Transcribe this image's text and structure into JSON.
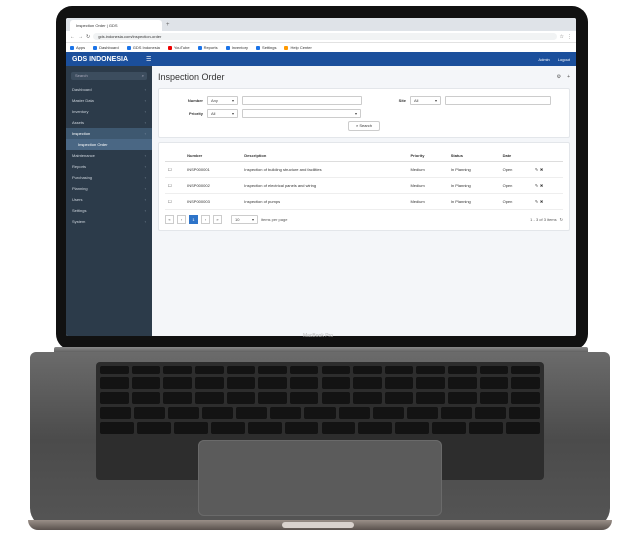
{
  "browser": {
    "tab_title": "Inspection Order | GDS",
    "address": "gds.indonesia.com/inspection-order",
    "bookmarks": [
      "Apps",
      "Dashboard",
      "GDS Indonesia",
      "YouTube",
      "Reports",
      "Inventory",
      "Settings",
      "Help Center"
    ]
  },
  "app": {
    "brand": "GDS INDONESIA",
    "user": [
      "Admin",
      "Logout"
    ],
    "search_placeholder": "Search",
    "menu": [
      {
        "label": "Dashboard"
      },
      {
        "label": "Master Data"
      },
      {
        "label": "Inventory"
      },
      {
        "label": "Assets"
      },
      {
        "label": "Inspection",
        "active": true
      },
      {
        "label": "Inspection Order",
        "sub": true,
        "active": true
      },
      {
        "label": "Maintenance"
      },
      {
        "label": "Reports"
      },
      {
        "label": "Purchasing"
      },
      {
        "label": "Planning"
      },
      {
        "label": "Users"
      },
      {
        "label": "Settings"
      },
      {
        "label": "System"
      }
    ],
    "page_title": "Inspection Order",
    "filters": {
      "number_label": "Number",
      "number_select": "Any",
      "priority_label": "Priority",
      "priority_select": "All",
      "site_label": "Site",
      "site_select": "All",
      "search_button": "Search"
    },
    "table": {
      "headers": [
        "",
        "Number",
        "Description",
        "Priority",
        "Status",
        "Date",
        ""
      ],
      "rows": [
        [
          "",
          "INSP000001",
          "Inspection of building structure and facilities",
          "Medium",
          "In Planning",
          "Open",
          ""
        ],
        [
          "",
          "INSP000002",
          "Inspection of electrical panels and wiring",
          "Medium",
          "In Planning",
          "Open",
          ""
        ],
        [
          "",
          "INSP000003",
          "Inspection of pumps",
          "Medium",
          "In Planning",
          "Open",
          ""
        ]
      ]
    },
    "pager": {
      "pages": [
        "«",
        "‹",
        "1",
        "›",
        "»"
      ],
      "per_page": "10",
      "per_page_label": "items per page",
      "summary": "1 - 3 of 3 items"
    }
  },
  "laptop_label": "MacBook Pro"
}
